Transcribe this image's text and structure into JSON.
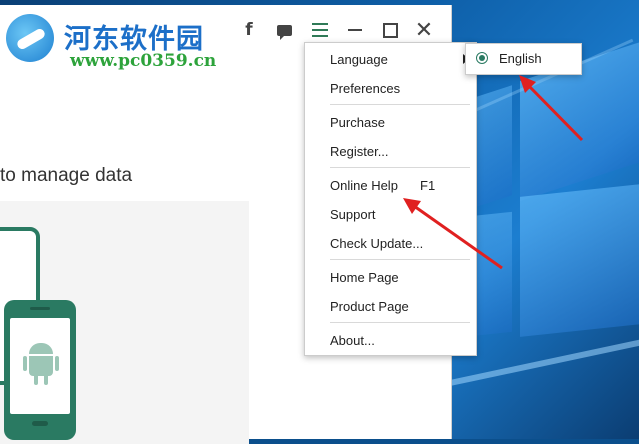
{
  "watermark": {
    "site_name": "河东软件园",
    "site_url": "www.pc0359.cn"
  },
  "titlebar": {
    "icons": [
      "facebook-icon",
      "chat-icon",
      "menu-icon",
      "minimize-icon",
      "maximize-icon",
      "close-icon"
    ],
    "facebook_glyph": "f",
    "close_glyph": "✕"
  },
  "main": {
    "headline": "to manage data"
  },
  "menu": {
    "items": [
      {
        "label": "Language",
        "submenu": true
      },
      {
        "label": "Preferences"
      },
      {
        "label": "Purchase"
      },
      {
        "label": "Register..."
      },
      {
        "label": "Online Help",
        "shortcut": "F1"
      },
      {
        "label": "Support"
      },
      {
        "label": "Check Update..."
      },
      {
        "label": "Home Page"
      },
      {
        "label": "Product Page"
      },
      {
        "label": "About..."
      }
    ]
  },
  "language_submenu": {
    "selected": "English"
  },
  "colors": {
    "accent": "#2a7a62",
    "annotation_arrow": "#e02020",
    "desktop": "#0e5fa8"
  }
}
